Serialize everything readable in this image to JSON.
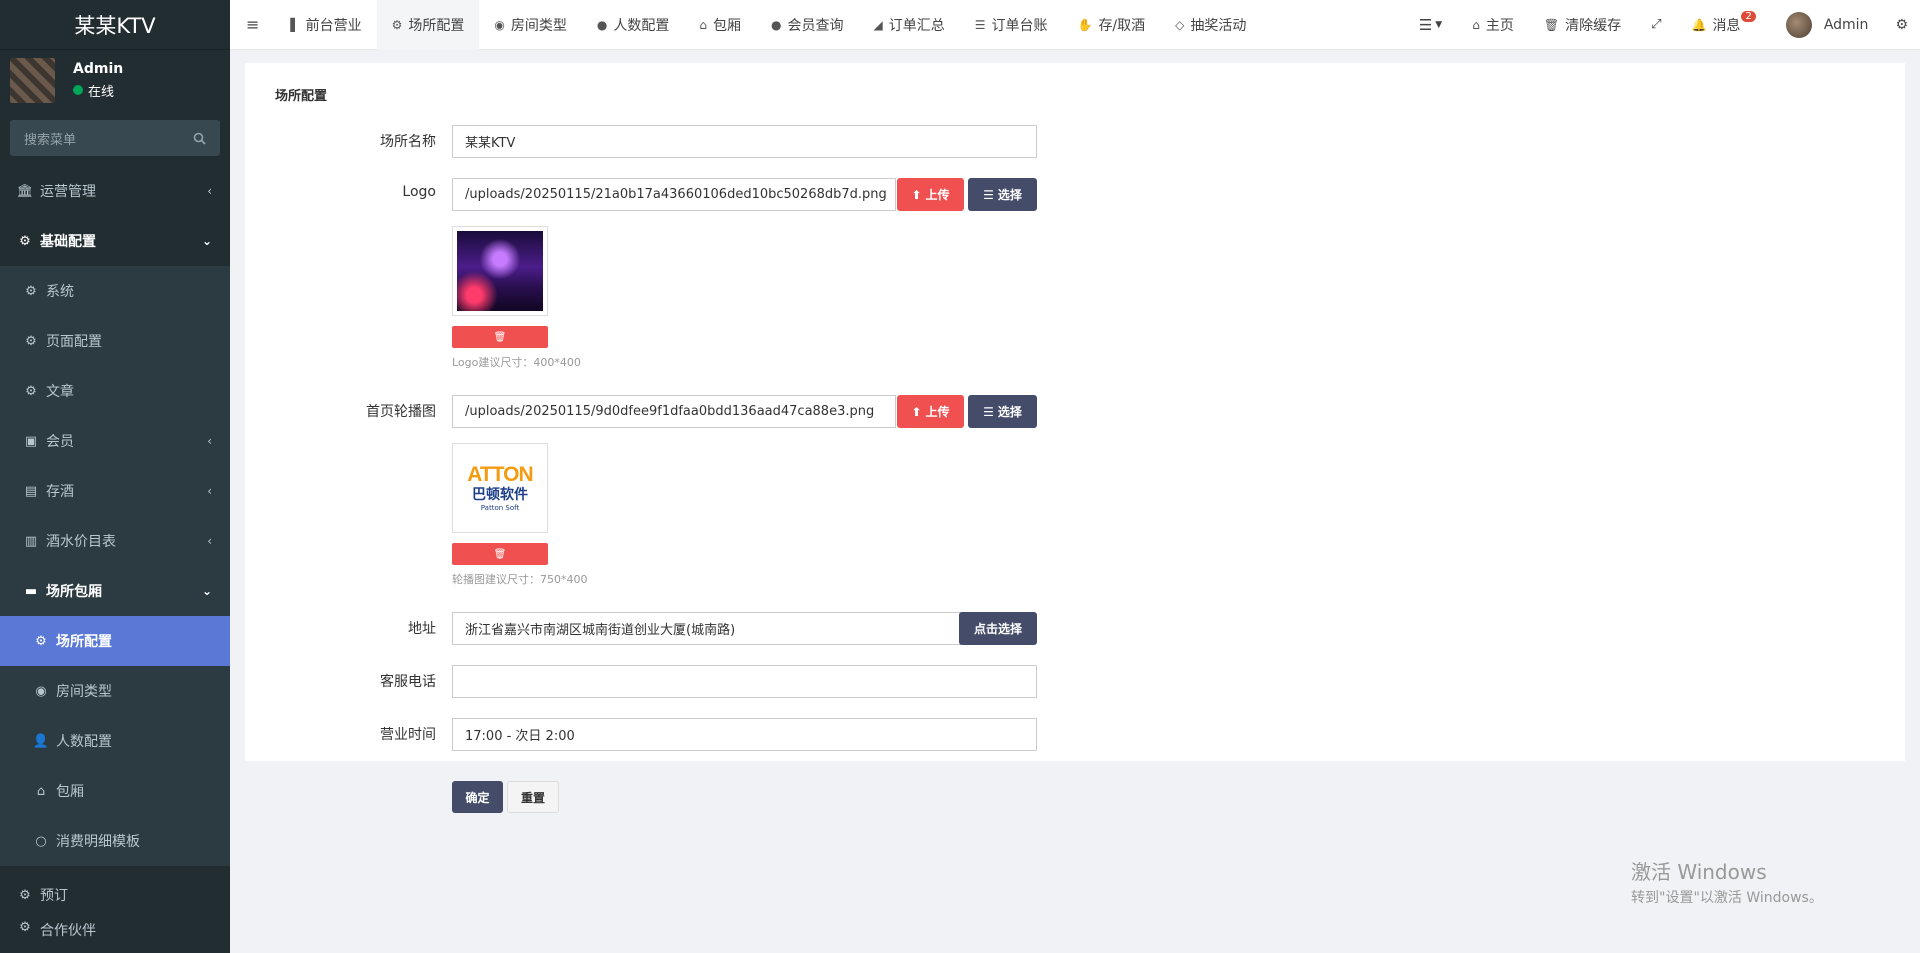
{
  "app": {
    "title": "某某KTV"
  },
  "user": {
    "name": "Admin",
    "status": "在线"
  },
  "search": {
    "placeholder": "搜索菜单"
  },
  "sidebar": {
    "items": [
      {
        "label": "运营管理",
        "icon": "bank-icon",
        "caret": "‹"
      },
      {
        "label": "基础配置",
        "icon": "cogs-icon",
        "caret": "⌄"
      },
      {
        "label": "系统",
        "icon": "gear-icon"
      },
      {
        "label": "页面配置",
        "icon": "gear-icon"
      },
      {
        "label": "文章",
        "icon": "cogs-icon"
      },
      {
        "label": "会员",
        "icon": "id-card-icon",
        "caret": "‹"
      },
      {
        "label": "存酒",
        "icon": "archive-icon",
        "caret": "‹"
      },
      {
        "label": "酒水价目表",
        "icon": "bottle-icon",
        "caret": "‹"
      },
      {
        "label": "场所包厢",
        "icon": "briefcase-icon",
        "caret": "⌄"
      },
      {
        "label": "场所配置",
        "icon": "cogs-icon"
      },
      {
        "label": "房间类型",
        "icon": "compass-icon"
      },
      {
        "label": "人数配置",
        "icon": "user-icon"
      },
      {
        "label": "包厢",
        "icon": "home-icon"
      },
      {
        "label": "消费明细模板",
        "icon": "circle-icon"
      },
      {
        "label": "预订",
        "icon": "cogs-icon"
      },
      {
        "label": "合作伙伴",
        "icon": "cogs-icon"
      }
    ]
  },
  "topnav": {
    "items": [
      {
        "label": "前台营业",
        "icon": "book-icon"
      },
      {
        "label": "场所配置",
        "icon": "cogs-icon"
      },
      {
        "label": "房间类型",
        "icon": "compass-icon"
      },
      {
        "label": "人数配置",
        "icon": "user-icon"
      },
      {
        "label": "包厢",
        "icon": "home-icon"
      },
      {
        "label": "会员查询",
        "icon": "user-icon"
      },
      {
        "label": "订单汇总",
        "icon": "area-chart-icon"
      },
      {
        "label": "订单台账",
        "icon": "list-icon"
      },
      {
        "label": "存/取酒",
        "icon": "hand-icon"
      },
      {
        "label": "抽奖活动",
        "icon": "diamond-icon"
      }
    ],
    "right": {
      "home": "主页",
      "clear_cache": "清除缓存",
      "messages": "消息",
      "message_count": "2",
      "user": "Admin"
    }
  },
  "form": {
    "title": "场所配置",
    "name_label": "场所名称",
    "name_value": "某某KTV",
    "logo_label": "Logo",
    "logo_value": "/uploads/20250115/21a0b17a43660106ded10bc50268db7d.png",
    "logo_hint": "Logo建议尺寸：400*400",
    "banner_label": "首页轮播图",
    "banner_value": "/uploads/20250115/9d0dfee9f1dfaa0bdd136aad47ca88e3.png",
    "banner_hint": "轮播图建议尺寸：750*400",
    "banner_brand": "ATTON",
    "banner_cn": "巴顿软件",
    "banner_en": "Patton Soft",
    "address_label": "地址",
    "address_value": "浙江省嘉兴市南湖区城南街道创业大厦(城南路)",
    "address_button": "点击选择",
    "phone_label": "客服电话",
    "phone_value": "",
    "hours_label": "营业时间",
    "hours_value": "17:00 - 次日 2:00",
    "upload": "上传",
    "choose": "选择",
    "submit": "确定",
    "reset": "重置"
  },
  "watermark": {
    "line1": "激活 Windows",
    "line2": "转到\"设置\"以激活 Windows。"
  },
  "colors": {
    "sidebar_bg": "#222d32",
    "active_item": "#5a79d6",
    "danger": "#f05050",
    "primary_dark": "#444c69"
  }
}
